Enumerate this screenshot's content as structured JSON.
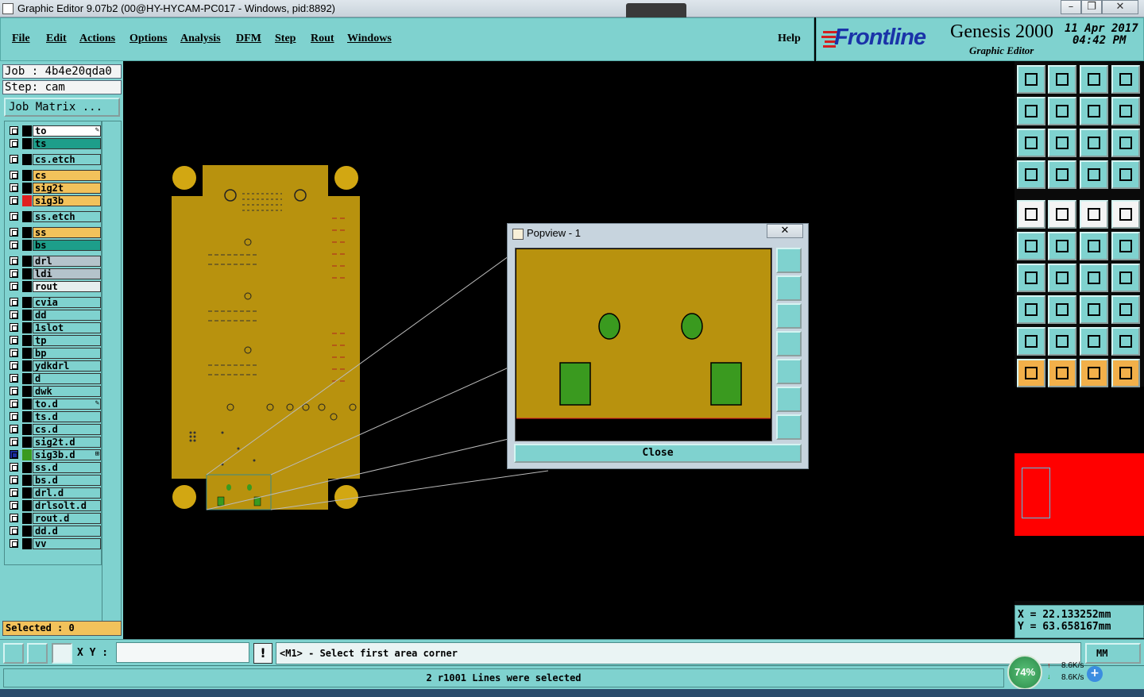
{
  "window": {
    "title": "Graphic Editor 9.07b2 (00@HY-HYCAM-PC017 - Windows, pid:8892)"
  },
  "menu": {
    "items": [
      "File",
      "Edit",
      "Actions",
      "Options",
      "Analysis",
      "DFM",
      "Step",
      "Rout",
      "Windows"
    ],
    "help": "Help"
  },
  "brand": {
    "logo": "Frontline",
    "product": "Genesis 2000",
    "subtitle": "Graphic Editor",
    "date": "11 Apr 2017",
    "time": "04:42 PM"
  },
  "job": {
    "job_label": "Job : 4b4e20qda0",
    "step_label": "Step: cam",
    "matrix_button": "Job Matrix ..."
  },
  "layers": [
    {
      "name": "to",
      "color": "#ffffff",
      "mark": "✎"
    },
    {
      "name": "ts",
      "color": "#1d9e8a",
      "mark": ""
    },
    {
      "name": "cs.etch",
      "color": "#7fd2cf",
      "mark": ""
    },
    {
      "name": "cs",
      "color": "#f2c25b",
      "mark": ""
    },
    {
      "name": "sig2t",
      "color": "#f2c25b",
      "mark": ""
    },
    {
      "name": "sig3b",
      "color": "#f2c25b",
      "mark": ""
    },
    {
      "name": "ss.etch",
      "color": "#7fd2cf",
      "mark": ""
    },
    {
      "name": "ss",
      "color": "#f2c25b",
      "mark": ""
    },
    {
      "name": "bs",
      "color": "#1d9e8a",
      "mark": ""
    },
    {
      "name": "drl",
      "color": "#b4c3cb",
      "mark": ""
    },
    {
      "name": "ldi",
      "color": "#b4c3cb",
      "mark": ""
    },
    {
      "name": "rout",
      "color": "#e6eeee",
      "mark": ""
    },
    {
      "name": "cvia",
      "color": "#7fd2cf",
      "mark": ""
    },
    {
      "name": "dd",
      "color": "#7fd2cf",
      "mark": ""
    },
    {
      "name": "1slot",
      "color": "#7fd2cf",
      "mark": ""
    },
    {
      "name": "tp",
      "color": "#7fd2cf",
      "mark": ""
    },
    {
      "name": "bp",
      "color": "#7fd2cf",
      "mark": ""
    },
    {
      "name": "ydkdrl",
      "color": "#7fd2cf",
      "mark": ""
    },
    {
      "name": "d",
      "color": "#7fd2cf",
      "mark": ""
    },
    {
      "name": "dwk",
      "color": "#7fd2cf",
      "mark": ""
    },
    {
      "name": "to.d",
      "color": "#7fd2cf",
      "mark": "✎"
    },
    {
      "name": "ts.d",
      "color": "#7fd2cf",
      "mark": ""
    },
    {
      "name": "cs.d",
      "color": "#7fd2cf",
      "mark": ""
    },
    {
      "name": "sig2t.d",
      "color": "#7fd2cf",
      "mark": ""
    },
    {
      "name": "sig3b.d",
      "color": "#7fd2cf",
      "mark": "⊞"
    },
    {
      "name": "ss.d",
      "color": "#7fd2cf",
      "mark": ""
    },
    {
      "name": "bs.d",
      "color": "#7fd2cf",
      "mark": ""
    },
    {
      "name": "drl.d",
      "color": "#7fd2cf",
      "mark": ""
    },
    {
      "name": "drlsolt.d",
      "color": "#7fd2cf",
      "mark": ""
    },
    {
      "name": "rout.d",
      "color": "#7fd2cf",
      "mark": ""
    },
    {
      "name": "dd.d",
      "color": "#7fd2cf",
      "mark": ""
    },
    {
      "name": "vv",
      "color": "#7fd2cf",
      "mark": ""
    }
  ],
  "selected": {
    "label": "Selected : 0"
  },
  "popview": {
    "title": "Popview - 1",
    "close_label": "Close"
  },
  "coords": {
    "x": "X = 22.133252mm",
    "y": "Y = 63.658167mm"
  },
  "command": {
    "xy_label": "X Y :",
    "xy_value": "",
    "prompt": "<M1> - Select first area corner",
    "units": "MM"
  },
  "status": {
    "message": "2 r1001 Lines were selected"
  },
  "netmeter": {
    "percent": "74%",
    "up": "8.6K/s",
    "down": "8.6K/s"
  },
  "colors": {
    "panel": "#7fd2cf",
    "board": "#b8920e",
    "pad": "#3a9a1f",
    "accent": "#e02020"
  }
}
